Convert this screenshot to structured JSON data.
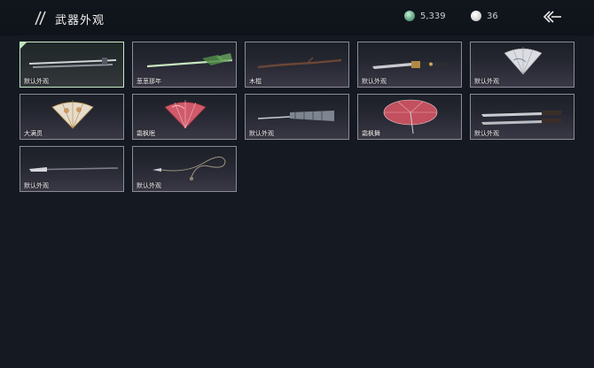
{
  "header": {
    "title": "武器外观",
    "currency_jade": "5,339",
    "currency_pearl": "36"
  },
  "skins": [
    {
      "label": "默认外观",
      "icon": "long-sword"
    },
    {
      "label": "葱葱那年",
      "icon": "green-bamboo-sword"
    },
    {
      "label": "木棍",
      "icon": "wooden-staff"
    },
    {
      "label": "默认外观",
      "icon": "ornate-blade"
    },
    {
      "label": "默认外观",
      "icon": "white-folding-fan"
    },
    {
      "label": "大满贯",
      "icon": "gold-folding-fan"
    },
    {
      "label": "霜枫眠",
      "icon": "red-folding-fan"
    },
    {
      "label": "默认外观",
      "icon": "closed-umbrella"
    },
    {
      "label": "霜枫舞",
      "icon": "red-umbrella"
    },
    {
      "label": "默认外观",
      "icon": "twin-blades"
    },
    {
      "label": "默认外观",
      "icon": "spear"
    },
    {
      "label": "默认外观",
      "icon": "rope-dart"
    }
  ]
}
